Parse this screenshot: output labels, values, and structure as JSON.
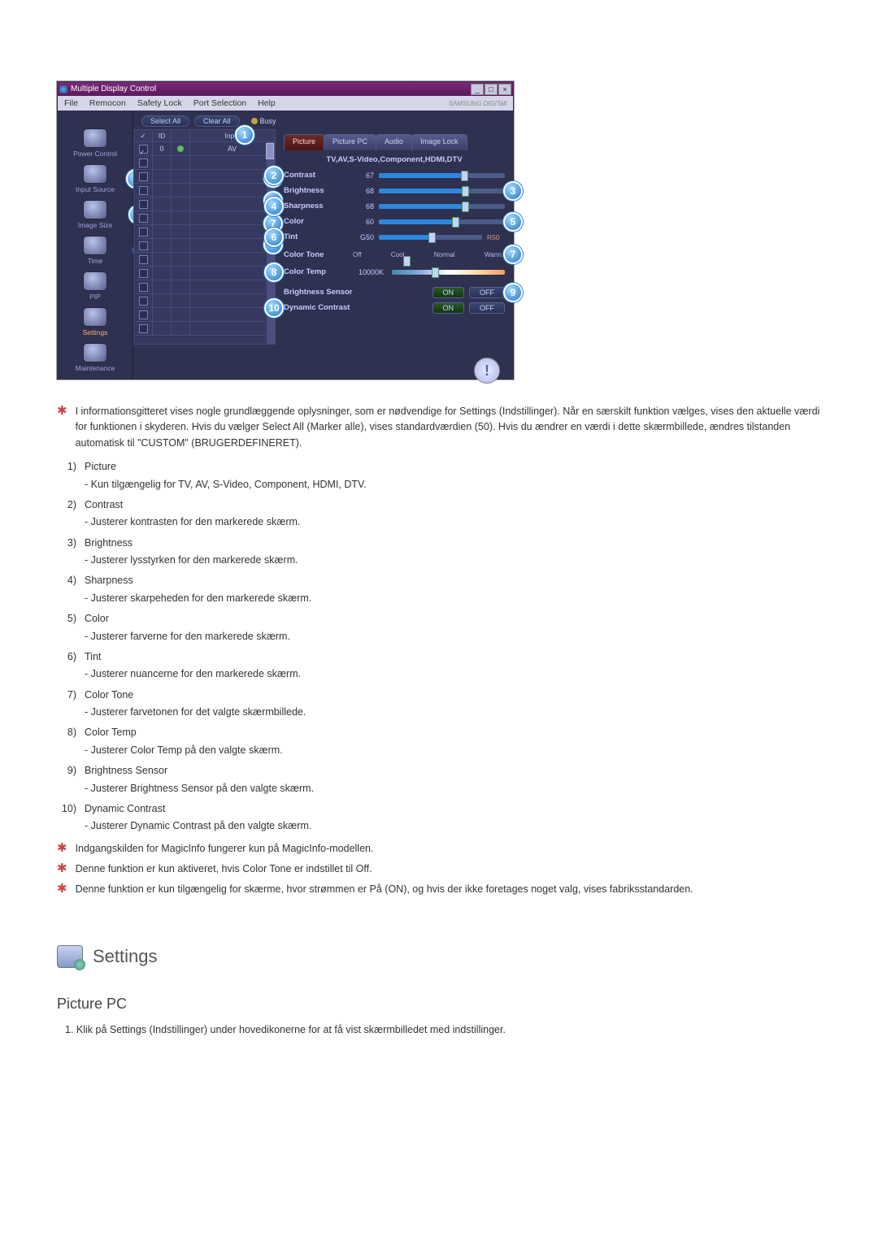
{
  "window": {
    "title": "Multiple Display Control",
    "menu": [
      "File",
      "Remocon",
      "Safety Lock",
      "Port Selection",
      "Help"
    ],
    "brand": "SAMSUNG DIGITall",
    "buttons": {
      "select_all": "Select All",
      "clear_all": "Clear All",
      "busy": "Busy"
    }
  },
  "sidebar": {
    "items": [
      {
        "label": "Power Control"
      },
      {
        "label": "Input Source"
      },
      {
        "label": "Image Size"
      },
      {
        "label": "Time"
      },
      {
        "label": "PIP"
      },
      {
        "label": "Settings",
        "selected": true
      },
      {
        "label": "Maintenance"
      }
    ]
  },
  "grid": {
    "headers": {
      "c1": "✓",
      "c2": "ID",
      "c3": "",
      "c4": "Input"
    },
    "rows": [
      {
        "chk": true,
        "id": "0",
        "st": "g",
        "input": "AV"
      },
      {
        "chk": false,
        "id": "",
        "st": "",
        "input": ""
      },
      {
        "chk": false,
        "id": "",
        "st": "",
        "input": ""
      },
      {
        "chk": false,
        "id": "",
        "st": "",
        "input": ""
      },
      {
        "chk": false,
        "id": "",
        "st": "",
        "input": ""
      },
      {
        "chk": false,
        "id": "",
        "st": "",
        "input": ""
      },
      {
        "chk": false,
        "id": "",
        "st": "",
        "input": ""
      },
      {
        "chk": false,
        "id": "",
        "st": "",
        "input": ""
      },
      {
        "chk": false,
        "id": "",
        "st": "",
        "input": ""
      },
      {
        "chk": false,
        "id": "",
        "st": "",
        "input": ""
      },
      {
        "chk": false,
        "id": "",
        "st": "",
        "input": ""
      },
      {
        "chk": false,
        "id": "",
        "st": "",
        "input": ""
      },
      {
        "chk": false,
        "id": "",
        "st": "",
        "input": ""
      },
      {
        "chk": false,
        "id": "",
        "st": "",
        "input": ""
      }
    ]
  },
  "panel": {
    "tabs": {
      "picture": "Picture",
      "picture_pc": "Picture PC",
      "audio": "Audio",
      "image_lock": "Image Lock"
    },
    "header": "TV,AV,S-Video,Component,HDMI,DTV",
    "contrast": {
      "label": "Contrast",
      "value": "67",
      "pct": 67
    },
    "brightness": {
      "label": "Brightness",
      "value": "68",
      "pct": 68
    },
    "sharpness": {
      "label": "Sharpness",
      "value": "68",
      "pct": 68
    },
    "color": {
      "label": "Color",
      "value": "60",
      "pct": 60
    },
    "tint": {
      "label": "Tint",
      "left": "G50",
      "right": "R50",
      "pct": 50
    },
    "color_tone": {
      "label": "Color Tone",
      "opts": [
        "Off",
        "Cool",
        "Normal",
        "Warm"
      ]
    },
    "color_temp": {
      "label": "Color Temp",
      "value": "10000K"
    },
    "b_sensor": {
      "label": "Brightness Sensor",
      "on": "ON",
      "off": "OFF"
    },
    "dyn": {
      "label": "Dynamic Contrast",
      "on": "ON",
      "off": "OFF"
    }
  },
  "callouts": {
    "c1": "1",
    "c2": "2",
    "c3": "3",
    "c4": "4",
    "c5": "5",
    "c6": "6",
    "c7": "7",
    "c8": "8",
    "c9": "9",
    "c10": "10",
    "s2": "2",
    "s3": "3",
    "s4": "4"
  },
  "text": {
    "star1": "I informationsgitteret vises nogle grundlæggende oplysninger, som er nødvendige for Settings (Indstillinger). Når en særskilt funktion vælges, vises den aktuelle værdi for funktionen i skyderen. Hvis du vælger Select All (Marker alle), vises standardværdien (50). Hvis du ændrer en værdi i dette skærmbillede, ændres tilstanden automatisk til \"CUSTOM\" (BRUGERDEFINERET).",
    "items": [
      {
        "n": "1)",
        "t": "Picture",
        "d": "- Kun tilgængelig for TV, AV, S-Video, Component, HDMI, DTV."
      },
      {
        "n": "2)",
        "t": "Contrast",
        "d": "- Justerer kontrasten for den markerede skærm."
      },
      {
        "n": "3)",
        "t": "Brightness",
        "d": "- Justerer lysstyrken for den markerede skærm."
      },
      {
        "n": "4)",
        "t": "Sharpness",
        "d": "- Justerer skarpeheden for den markerede skærm."
      },
      {
        "n": "5)",
        "t": "Color",
        "d": "- Justerer farverne for den markerede skærm."
      },
      {
        "n": "6)",
        "t": "Tint",
        "d": "- Justerer nuancerne for den markerede skærm."
      },
      {
        "n": "7)",
        "t": "Color Tone",
        "d": "- Justerer farvetonen for det valgte skærmbillede."
      },
      {
        "n": "8)",
        "t": "Color Temp",
        "d": "- Justerer Color Temp på den valgte skærm."
      },
      {
        "n": "9)",
        "t": "Brightness Sensor",
        "d": "- Justerer Brightness Sensor på den valgte skærm."
      },
      {
        "n": "10)",
        "t": "Dynamic Contrast",
        "d": "- Justerer Dynamic Contrast på den valgte skærm."
      }
    ],
    "star2": "Indgangskilden for MagicInfo fungerer kun på MagicInfo-modellen.",
    "star3": "Denne funktion er kun aktiveret, hvis Color Tone er indstillet til Off.",
    "star4": "Denne funktion er kun tilgængelig for skærme, hvor strømmen er På (ON), og hvis der ikke foretages noget valg, vises fabriksstandarden.",
    "section": "Settings",
    "subsection": "Picture PC",
    "step1": "1. Klik på Settings (Indstillinger) under hovedikonerne for at få vist skærmbilledet med indstillinger."
  }
}
